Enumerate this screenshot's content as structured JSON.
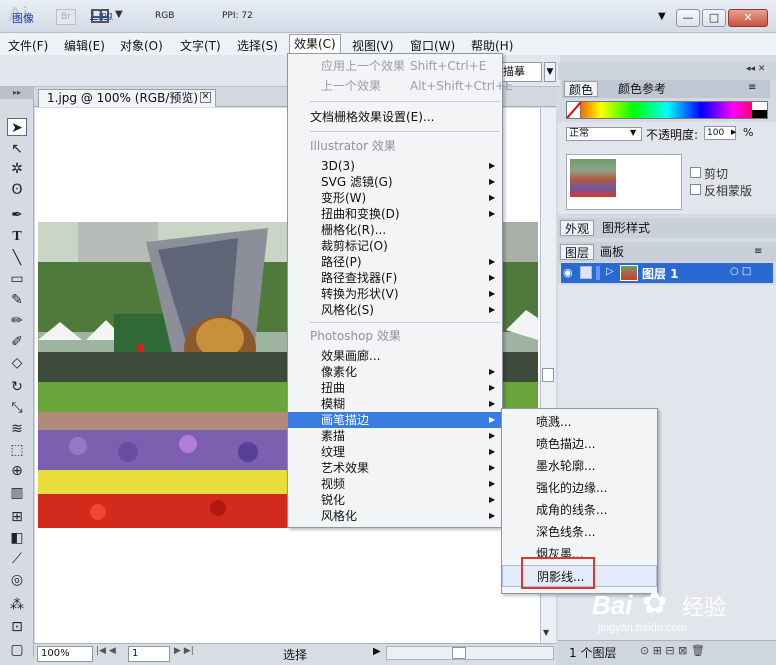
{
  "titlebar": {
    "app_logo": "Ai",
    "bridge_badge": "Br",
    "window_buttons": [
      "—",
      "□",
      "✕"
    ]
  },
  "menubar": {
    "items": [
      "文件(F)",
      "编辑(E)",
      "对象(O)",
      "文字(T)",
      "选择(S)",
      "效果(C)",
      "视图(V)",
      "窗口(W)",
      "帮助(H)"
    ]
  },
  "controlbar": {
    "image_label": "图像",
    "file_name": "1.jpg",
    "color_mode": "RGB",
    "ppi": "PPI: 72",
    "desc_field": "描摹"
  },
  "document": {
    "tab_title": "1.jpg @ 100% (RGB/预览)",
    "zoom": "100%",
    "page": "1",
    "status_mode": "选择"
  },
  "effect_menu": {
    "apply_last": "应用上一个效果",
    "apply_last_shortcut": "Shift+Ctrl+E",
    "last_effect": "上一个效果",
    "last_effect_shortcut": "Alt+Shift+Ctrl+E",
    "raster_settings": "文档栅格效果设置(E)...",
    "illustrator_header": "Illustrator 效果",
    "illustrator_items": [
      "3D(3)",
      "SVG 滤镜(G)",
      "变形(W)",
      "扭曲和变换(D)",
      "栅格化(R)...",
      "裁剪标记(O)",
      "路径(P)",
      "路径查找器(F)",
      "转换为形状(V)",
      "风格化(S)"
    ],
    "photoshop_header": "Photoshop 效果",
    "photoshop_items": [
      "效果画廊...",
      "像素化",
      "扭曲",
      "模糊",
      "画笔描边",
      "素描",
      "纹理",
      "艺术效果",
      "视频",
      "锐化",
      "风格化"
    ],
    "highlighted": "画笔描边"
  },
  "brush_submenu": {
    "items": [
      "喷溅...",
      "喷色描边...",
      "墨水轮廓...",
      "强化的边缘...",
      "成角的线条...",
      "深色线条...",
      "烟灰墨...",
      "阴影线..."
    ],
    "highlighted": "阴影线..."
  },
  "panels": {
    "color_tab": "颜色",
    "color_guide_tab": "颜色参考",
    "blend_mode": "正常",
    "opacity_label": "不透明度:",
    "opacity_value": "100",
    "opacity_unit": "%",
    "clip_label": "剪切",
    "invert_mask_label": "反相蒙版",
    "appearance_tab": "外观",
    "graphic_styles_tab": "图形样式",
    "layers_tab": "图层",
    "artboards_tab": "画板",
    "layer_name": "图层 1",
    "layers_count": "1 个图层"
  },
  "watermark": {
    "brand": "Bai",
    "brand2": "经验",
    "url": "jingyan.baidu.com"
  },
  "colors": {
    "menu_highlight": "#3a7be0",
    "layer_highlight": "#2a68d2",
    "callout_red": "#d83a2b"
  }
}
